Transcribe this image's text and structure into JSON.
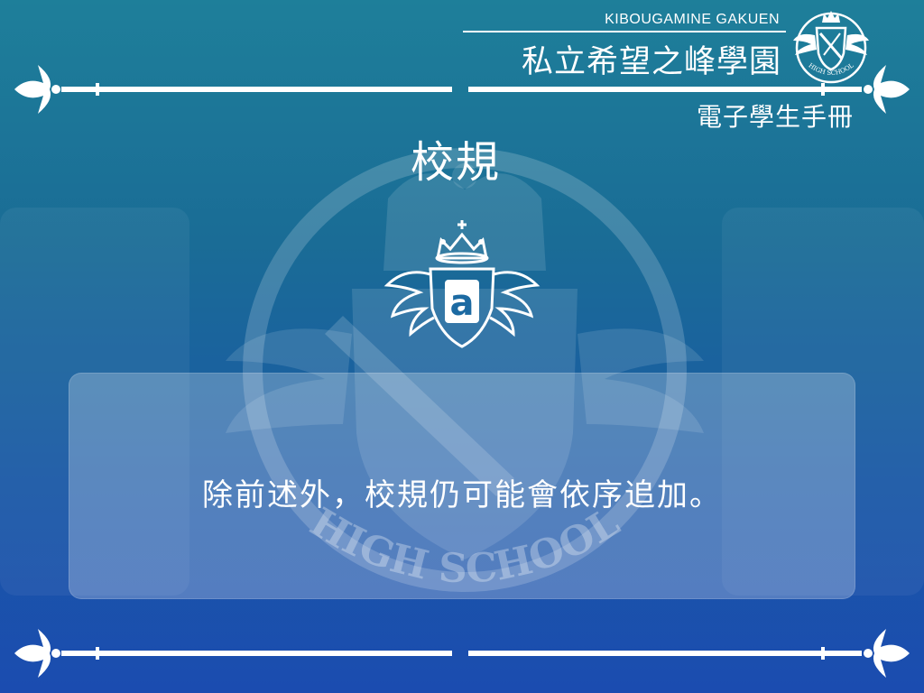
{
  "header": {
    "school_en": "KIBOUGAMINE GAKUEN",
    "school_name": "私立希望之峰學園",
    "subtitle": "電子學生手冊",
    "logo_text": "HIGH SCHOOL"
  },
  "background": {
    "emblem_text": "HIGH SCHOOL"
  },
  "page": {
    "title": "校規",
    "badge_letter": "a"
  },
  "message": {
    "text": "除前述外，校規仍可能會依序追加。"
  },
  "colors": {
    "bg_top": "#1e7f9a",
    "bg_bottom": "#1b4cb0",
    "foreground": "#ffffff"
  },
  "icons": [
    "school-crest-icon",
    "fleur-de-lis-icon",
    "crown-icon",
    "wing-badge-icon"
  ]
}
